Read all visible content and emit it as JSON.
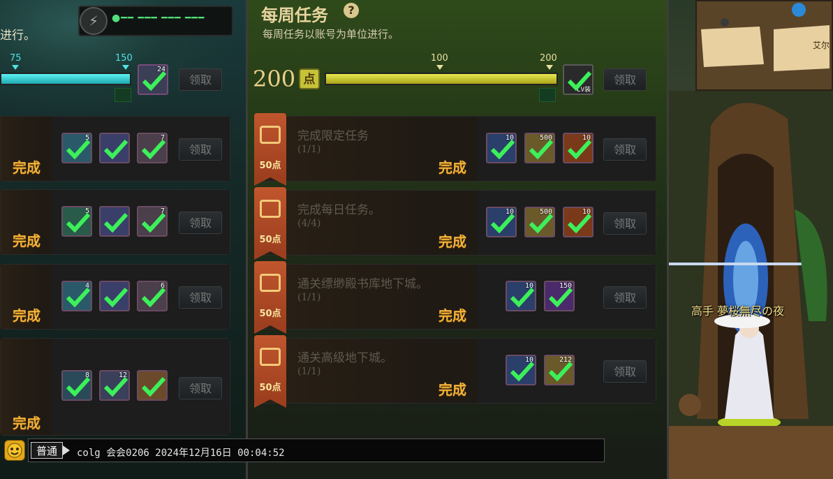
{
  "left": {
    "note": "进行。",
    "status_text": "●━━ ━━━ ━━━ ━━━",
    "tick_75": "75",
    "tick_150": "150",
    "top_reward_count": "24",
    "claim": "领取",
    "done": "完成",
    "rows": [
      {
        "counts": [
          "5",
          "",
          "7"
        ]
      },
      {
        "counts": [
          "5",
          "",
          "7"
        ]
      },
      {
        "counts": [
          "4",
          "",
          "6"
        ]
      },
      {
        "counts": [
          "8",
          "12",
          ""
        ]
      }
    ]
  },
  "weekly": {
    "title": "每周任务",
    "help": "?",
    "subtitle": "每周任务以账号为单位进行。",
    "points_value": "200",
    "points_tag": "点",
    "tick_100": "100",
    "tick_200": "200",
    "progress": 1.0,
    "top_reward_label": "LV装",
    "claim": "领取",
    "done": "完成",
    "tasks": [
      {
        "title": "完成限定任务",
        "progress": "(1/1)",
        "points": "50点",
        "rewards": [
          "10",
          "500",
          "10"
        ]
      },
      {
        "title": "完成每日任务。",
        "progress": "(4/4)",
        "points": "50点",
        "rewards": [
          "10",
          "500",
          "10"
        ]
      },
      {
        "title": "通关缥缈殿书库地下城。",
        "progress": "(1/1)",
        "points": "50点",
        "rewards": [
          "10",
          "150"
        ]
      },
      {
        "title": "通关高级地下城。",
        "progress": "(1/1)",
        "points": "50点",
        "rewards": [
          "10",
          "212"
        ]
      }
    ]
  },
  "scene": {
    "player_name": "高手 夢桜無尽の夜",
    "minimap_label": "艾尔"
  },
  "chat": {
    "channel": "普通",
    "message": "colg 会会0206 2024年12月16日 00:04:52"
  },
  "colors": {
    "accent_gold": "#f2b33a",
    "check_green": "#3cf05a",
    "cyan_bar": "#2ad4d4",
    "olive_bar": "#c9c82e"
  }
}
